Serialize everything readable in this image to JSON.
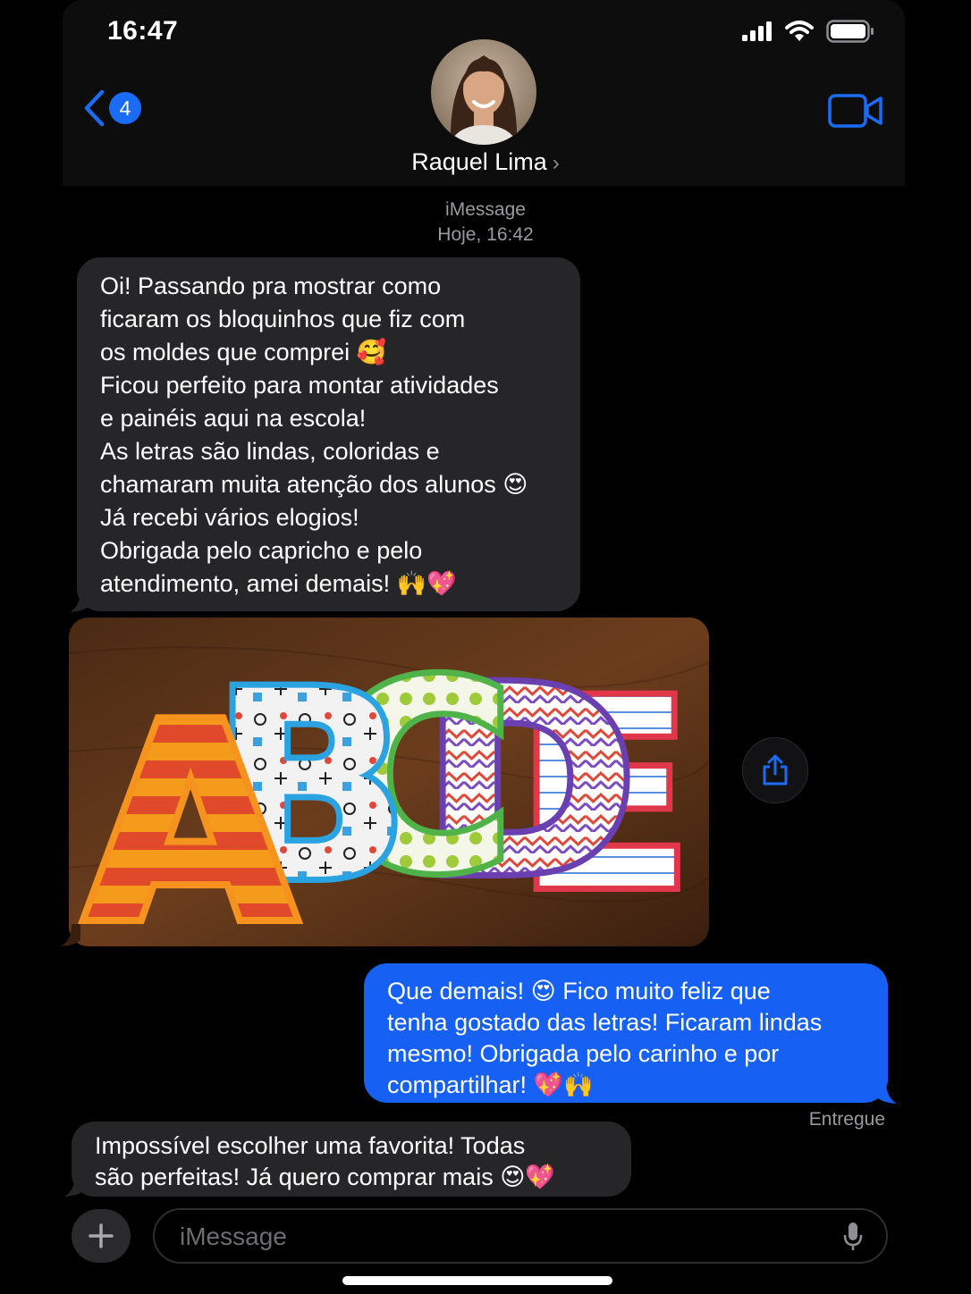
{
  "status_bar": {
    "time": "16:47"
  },
  "header": {
    "back_badge": "4",
    "contact_name": "Raquel Lima",
    "chevron": "›",
    "back_icon": "chevron-left-icon",
    "video_icon": "video-camera-icon",
    "accent_color": "#1b6cf5"
  },
  "thread": {
    "service": "iMessage",
    "timestamp": "Hoje, 16:42",
    "messages": [
      {
        "direction": "incoming",
        "lines": [
          "Oi! Passando pra mostrar como",
          "ficaram os bloquinhos que fiz com",
          "os moldes que comprei 🥰",
          "Ficou perfeito para montar atividades",
          "e painéis aqui na escola!",
          "As letras são lindas, coloridas e",
          "chamaram muita atenção dos alunos 😍",
          "Já recebi vários elogios!",
          "Obrigada pelo capricho e pelo",
          "atendimento, amei demais! 🙌💖"
        ]
      },
      {
        "direction": "incoming",
        "image_letters": [
          "A",
          "B",
          "C",
          "D",
          "E"
        ]
      },
      {
        "direction": "outgoing",
        "lines": [
          "Que demais! 😍 Fico muito feliz que",
          "tenha gostado das letras! Ficaram lindas",
          "mesmo! Obrigada pelo carinho e por",
          "compartilhar! 💖🙌"
        ]
      },
      {
        "direction": "incoming",
        "lines": [
          "Impossível escolher uma favorita! Todas",
          "são perfeitas! Já quero comprar mais 😍💖"
        ]
      }
    ],
    "delivered_label": "Entregue"
  },
  "composer": {
    "placeholder": "iMessage",
    "plus_icon": "plus-icon",
    "mic_icon": "microphone-icon"
  },
  "colors": {
    "incoming_bubble": "#262628",
    "outgoing_bubble": "#1660f4"
  }
}
